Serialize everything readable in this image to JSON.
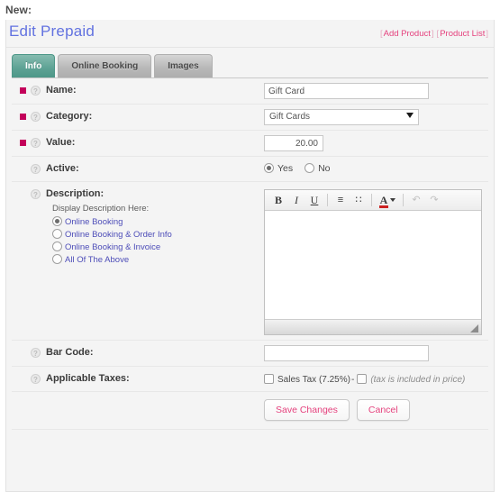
{
  "page": {
    "kicker": "New:",
    "title": "Edit Prepaid"
  },
  "title_links": {
    "bracket_open": "[",
    "bracket_close": "]",
    "add_product": "Add Product",
    "product_list": "Product List"
  },
  "tabs": [
    {
      "label": "Info",
      "active": true
    },
    {
      "label": "Online Booking",
      "active": false
    },
    {
      "label": "Images",
      "active": false
    }
  ],
  "fields": {
    "name": {
      "label": "Name:",
      "required": true,
      "value": "Gift Card",
      "placeholder": ""
    },
    "category": {
      "label": "Category:",
      "required": true,
      "selected": "Gift Cards",
      "options": [
        "Gift Cards"
      ]
    },
    "value": {
      "label": "Value:",
      "required": true,
      "value": "20.00",
      "placeholder": ""
    },
    "active": {
      "label": "Active:",
      "required": false,
      "options": [
        {
          "label": "Yes",
          "checked": true
        },
        {
          "label": "No",
          "checked": false
        }
      ]
    },
    "description": {
      "label": "Description:",
      "required": false,
      "display_title": "Display Description Here:",
      "display_options": [
        {
          "label": "Online Booking",
          "checked": true
        },
        {
          "label": "Online Booking & Order Info",
          "checked": false
        },
        {
          "label": "Online Booking & Invoice",
          "checked": false
        },
        {
          "label": "All Of The Above",
          "checked": false
        }
      ],
      "editor": {
        "content": "",
        "toolbar": [
          {
            "name": "bold-button",
            "glyph": "B"
          },
          {
            "name": "italic-button",
            "glyph": "I"
          },
          {
            "name": "underline-button",
            "glyph": "U"
          },
          {
            "name": "ordered-list-button",
            "glyph": "≡"
          },
          {
            "name": "unordered-list-button",
            "glyph": "∷"
          },
          {
            "name": "font-color-button",
            "glyph": "A"
          },
          {
            "name": "undo-button",
            "glyph": "↶"
          },
          {
            "name": "redo-button",
            "glyph": "↷"
          }
        ]
      }
    },
    "bar_code": {
      "label": "Bar Code:",
      "required": false,
      "value": "",
      "placeholder": ""
    },
    "applicable_taxes": {
      "label": "Applicable Taxes:",
      "required": false,
      "tax_name": "Sales Tax (7.25%)",
      "separator": "-",
      "tax_checked": false,
      "included_checked": false,
      "included_note": "(tax is included in price)"
    }
  },
  "buttons": {
    "save": "Save Changes",
    "cancel": "Cancel"
  },
  "colors": {
    "title": "#6272e0",
    "link": "#e5417d",
    "required_mark": "#c3005a",
    "active_tab": "#5da294",
    "radio_label": "#4d4db8"
  }
}
